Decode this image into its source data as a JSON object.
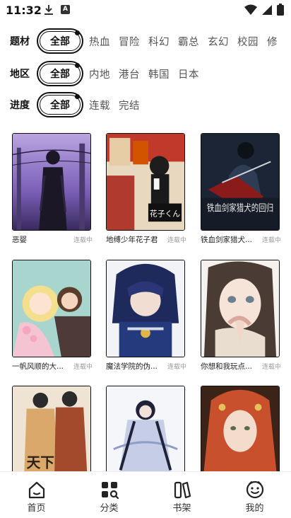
{
  "status": {
    "time": "11:32",
    "a_badge": "A"
  },
  "filters": [
    {
      "label": "题材",
      "all": "全部",
      "options": [
        "热血",
        "冒险",
        "科幻",
        "霸总",
        "玄幻",
        "校园",
        "修"
      ]
    },
    {
      "label": "地区",
      "all": "全部",
      "options": [
        "内地",
        "港台",
        "韩国",
        "日本"
      ]
    },
    {
      "label": "进度",
      "all": "全部",
      "options": [
        "连载",
        "完结"
      ]
    }
  ],
  "comics": [
    {
      "title": "恶婴",
      "status": "连载中",
      "cover_text": ""
    },
    {
      "title": "地缚少年花子君",
      "status": "连载中",
      "cover_text": "花子くん"
    },
    {
      "title": "铁血剑家猎犬...",
      "status": "连载中",
      "cover_text": "铁血剑家猎犬的回归"
    },
    {
      "title": "一帆风顺的大...",
      "status": "连载中",
      "cover_text": ""
    },
    {
      "title": "魔法学院的伪...",
      "status": "连载中",
      "cover_text": ""
    },
    {
      "title": "你想和我玩点...",
      "status": "连载中",
      "cover_text": ""
    },
    {
      "title": "",
      "status": "",
      "cover_text": "天下"
    },
    {
      "title": "",
      "status": "",
      "cover_text": ""
    },
    {
      "title": "",
      "status": "",
      "cover_text": ""
    }
  ],
  "nav": [
    {
      "label": "首页",
      "icon": "home-icon"
    },
    {
      "label": "分类",
      "icon": "category-icon"
    },
    {
      "label": "书架",
      "icon": "bookshelf-icon"
    },
    {
      "label": "我的",
      "icon": "profile-icon"
    }
  ],
  "colors": {
    "text": "#222222",
    "muted": "#999999",
    "accent": "#111111"
  }
}
